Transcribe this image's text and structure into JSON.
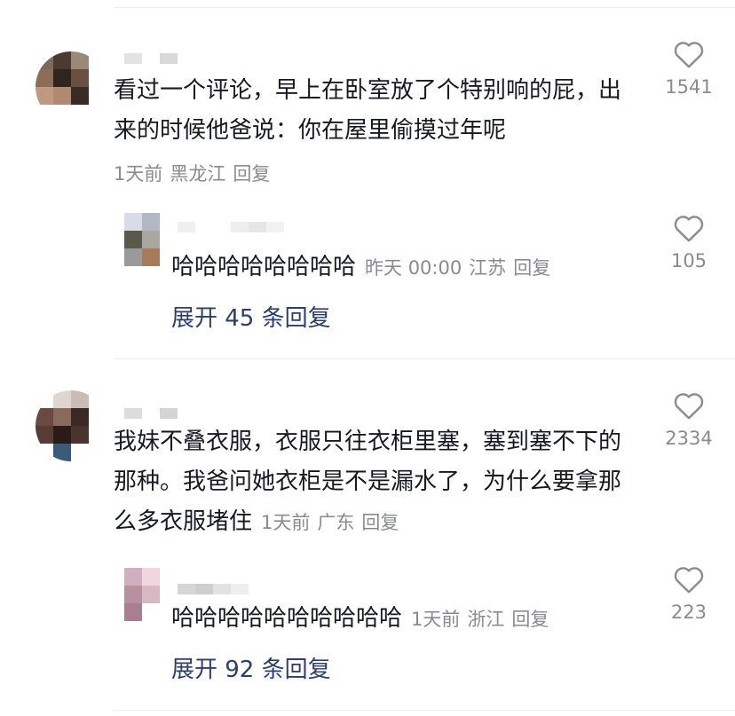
{
  "comments": [
    {
      "text": "看过一个评论，早上在卧室放了个特别响的屁，出来的时候他爸说：你在屋里偷摸过年呢",
      "time": "1天前",
      "location": "黑龙江",
      "reply_label": "回复",
      "likes": "1541",
      "top_reply": {
        "text": "哈哈哈哈哈哈哈哈",
        "time": "昨天 00:00",
        "location": "江苏",
        "reply_label": "回复",
        "likes": "105"
      },
      "expand_label": "展开 45 条回复"
    },
    {
      "text": "我妹不叠衣服，衣服只往衣柜里塞，塞到塞不下的那种。我爸问她衣柜是不是漏水了，为什么要拿那么多衣服堵住",
      "time": "1天前",
      "location": "广东",
      "reply_label": "回复",
      "likes": "2334",
      "top_reply": {
        "text": "哈哈哈哈哈哈哈哈哈哈",
        "time": "1天前",
        "location": "浙江",
        "reply_label": "回复",
        "likes": "223"
      },
      "expand_label": "展开 92 条回复"
    }
  ],
  "icons": {
    "like": "heart-outline-icon"
  },
  "colors": {
    "text": "#161823",
    "meta": "#8a8b91",
    "link": "#2c3f6b"
  }
}
